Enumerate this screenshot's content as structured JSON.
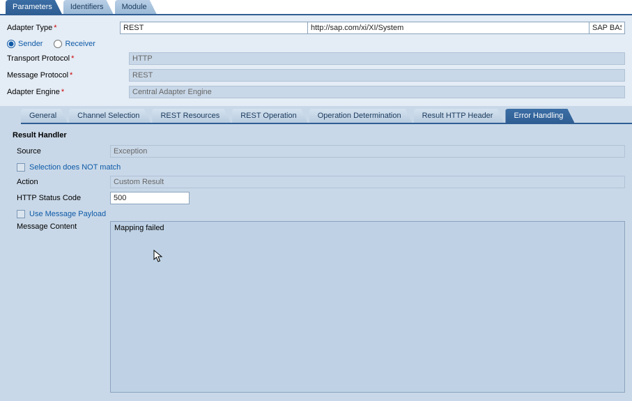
{
  "topTabs": {
    "parameters": "Parameters",
    "identifiers": "Identifiers",
    "module": "Module"
  },
  "config": {
    "adapterTypeLabel": "Adapter Type",
    "adapterTypeValue": "REST",
    "adapterNamespace": "http://sap.com/xi/XI/System",
    "adapterSwcv": "SAP BAS",
    "senderLabel": "Sender",
    "receiverLabel": "Receiver",
    "transportProtocolLabel": "Transport Protocol",
    "transportProtocolValue": "HTTP",
    "messageProtocolLabel": "Message Protocol",
    "messageProtocolValue": "REST",
    "adapterEngineLabel": "Adapter Engine",
    "adapterEngineValue": "Central Adapter Engine"
  },
  "subTabs": {
    "general": "General",
    "channelSelection": "Channel Selection",
    "restResources": "REST Resources",
    "restOperation": "REST Operation",
    "operationDetermination": "Operation Determination",
    "resultHttpHeader": "Result HTTP Header",
    "errorHandling": "Error Handling"
  },
  "resultHandler": {
    "title": "Result Handler",
    "sourceLabel": "Source",
    "sourceValue": "Exception",
    "selectionNotMatchLabel": "Selection does NOT match",
    "actionLabel": "Action",
    "actionValue": "Custom Result",
    "httpStatusLabel": "HTTP Status Code",
    "httpStatusValue": "500",
    "useMessagePayloadLabel": "Use Message Payload",
    "messageContentLabel": "Message Content",
    "messageContentValue": "Mapping failed"
  }
}
